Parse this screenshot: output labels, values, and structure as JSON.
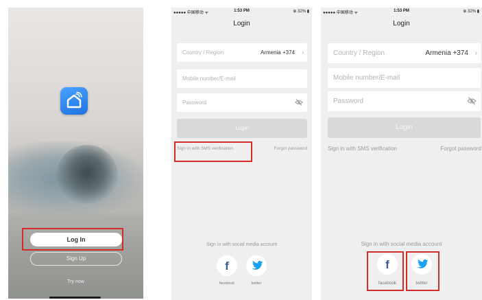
{
  "colors": {
    "brand_blue": "#2a86f0",
    "highlight_red": "#d42a2a",
    "facebook_blue": "#3b5998",
    "twitter_blue": "#1da1f2"
  },
  "welcome": {
    "app_icon": "home-wifi-icon",
    "login_label": "Log In",
    "signup_label": "Sign Up",
    "try_now_label": "Try now"
  },
  "status_bar": {
    "carrier": "●●●●● 中国移动 ᯤ",
    "time": "1:53 PM",
    "battery": "⊕ 32% ▮"
  },
  "login": {
    "title": "Login",
    "country_label": "Country / Region",
    "country_value": "Armenia +374",
    "mobile_placeholder": "Mobile number/E-mail",
    "password_placeholder": "Password",
    "login_button": "Login",
    "sms_link": "Sign in with SMS verification",
    "forgot_link": "Forgot password",
    "social_title": "Sign in with social media account",
    "facebook_label": "facebook",
    "twitter_label": "twitter"
  }
}
